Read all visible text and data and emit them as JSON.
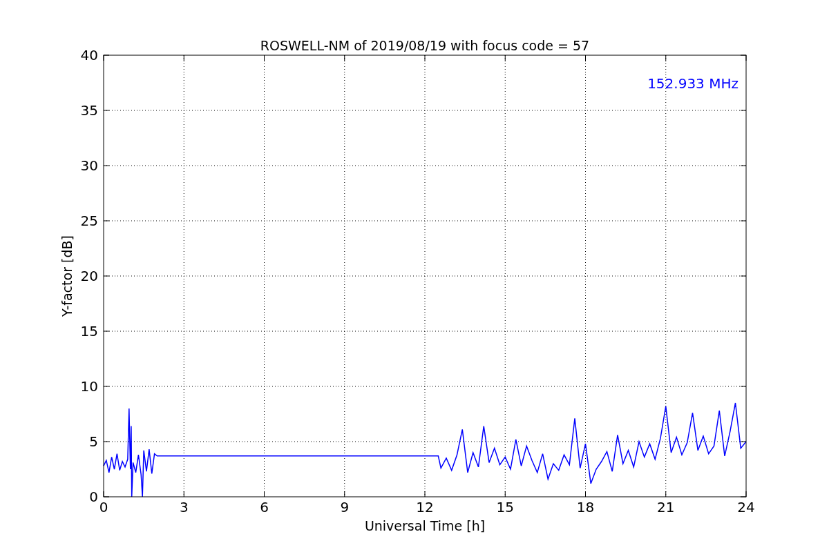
{
  "chart": {
    "chart_data": {
      "type": "line",
      "title": "ROSWELL-NM of 2019/08/19 with focus code = 57",
      "xlabel": "Universal Time [h]",
      "ylabel": "Y-factor [dB]",
      "x": [
        0,
        0.1,
        0.2,
        0.3,
        0.4,
        0.5,
        0.6,
        0.7,
        0.8,
        0.9,
        0.95,
        1.0,
        1.03,
        1.05,
        1.1,
        1.2,
        1.3,
        1.4,
        1.45,
        1.5,
        1.6,
        1.7,
        1.8,
        1.9,
        2.0,
        12.5,
        12.6,
        12.8,
        13.0,
        13.2,
        13.4,
        13.6,
        13.8,
        14.0,
        14.2,
        14.4,
        14.6,
        14.8,
        15.0,
        15.2,
        15.4,
        15.6,
        15.8,
        16.0,
        16.2,
        16.4,
        16.6,
        16.8,
        17.0,
        17.2,
        17.4,
        17.6,
        17.8,
        18.0,
        18.2,
        18.4,
        18.6,
        18.8,
        19.0,
        19.2,
        19.4,
        19.6,
        19.8,
        20.0,
        20.2,
        20.4,
        20.6,
        20.8,
        21.0,
        21.2,
        21.4,
        21.6,
        21.8,
        22.0,
        22.2,
        22.4,
        22.6,
        22.8,
        23.0,
        23.2,
        23.4,
        23.6,
        23.8,
        24.0
      ],
      "series": [
        {
          "name": "152.933 MHz",
          "color": "#0000ff",
          "values": [
            2.8,
            3.3,
            2.2,
            3.6,
            2.5,
            3.9,
            2.4,
            3.2,
            2.7,
            3.4,
            8.0,
            2.5,
            6.4,
            0,
            3.1,
            2.2,
            3.8,
            2.0,
            0,
            4.2,
            2.3,
            4.3,
            2.1,
            3.9,
            3.7,
            3.7,
            2.6,
            3.5,
            2.4,
            3.8,
            6.1,
            2.2,
            4.0,
            2.7,
            6.4,
            3.1,
            4.4,
            2.9,
            3.6,
            2.5,
            5.2,
            2.8,
            4.6,
            3.3,
            2.2,
            3.9,
            1.6,
            3.0,
            2.4,
            3.8,
            2.9,
            7.1,
            2.6,
            4.8,
            1.2,
            2.5,
            3.2,
            4.1,
            2.3,
            5.6,
            3.0,
            4.2,
            2.7,
            5.0,
            3.6,
            4.8,
            3.4,
            5.3,
            8.2,
            4.0,
            5.4,
            3.8,
            4.9,
            7.6,
            4.2,
            5.5,
            3.9,
            4.6,
            7.8,
            3.7,
            5.9,
            8.5,
            4.4,
            5.0
          ]
        }
      ],
      "xlim": [
        0,
        24
      ],
      "ylim": [
        0,
        40
      ],
      "grid": true,
      "xticks": [
        0,
        3,
        6,
        9,
        12,
        15,
        18,
        21,
        24
      ],
      "yticks": [
        0,
        5,
        10,
        15,
        20,
        25,
        30,
        35,
        40
      ]
    }
  }
}
